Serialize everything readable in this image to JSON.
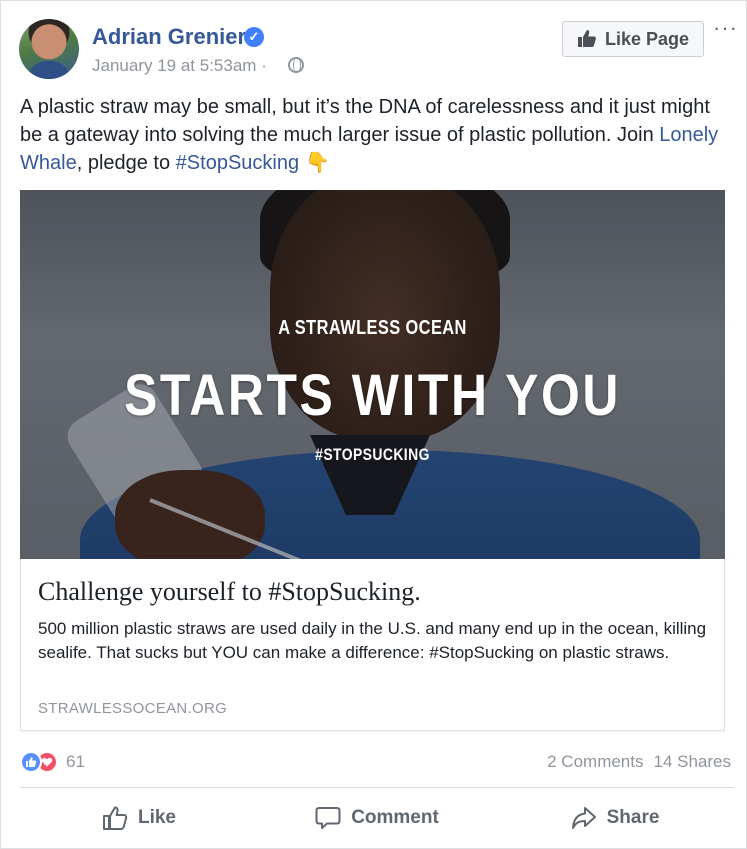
{
  "post": {
    "author": "Adrian Grenier",
    "timestamp": "January 19 at 5:53am",
    "separator": "·",
    "text": {
      "part1": "A plastic straw may be small, but it’s the DNA of carelessness and it just might be a gateway into solving the much larger issue of plastic pollution. Join ",
      "link1": "Lonely Whale",
      "part2": ", pledge to ",
      "hashtag": "#StopSucking",
      "emoji": "👇"
    }
  },
  "header": {
    "like_page_label": "Like Page",
    "more_label": "···"
  },
  "media": {
    "line1": "A STRAWLESS OCEAN",
    "line2": "STARTS WITH YOU",
    "line3": "#STOPSUCKING"
  },
  "link_preview": {
    "title": "Challenge yourself to #StopSucking.",
    "description": "500 million plastic straws are used daily in the U.S. and many end up in the ocean, killing sealife. That sucks but YOU can make a difference: #StopSucking on plastic straws.",
    "domain": "STRAWLESSOCEAN.ORG"
  },
  "engagement": {
    "reaction_count": "61",
    "comments": "2 Comments",
    "shares": "14 Shares"
  },
  "actions": {
    "like": "Like",
    "comment": "Comment",
    "share": "Share"
  },
  "colors": {
    "link": "#365899",
    "meta": "#90949c",
    "like_reaction": "#5890ff",
    "love_reaction": "#f25268",
    "verified": "#4080ff"
  }
}
